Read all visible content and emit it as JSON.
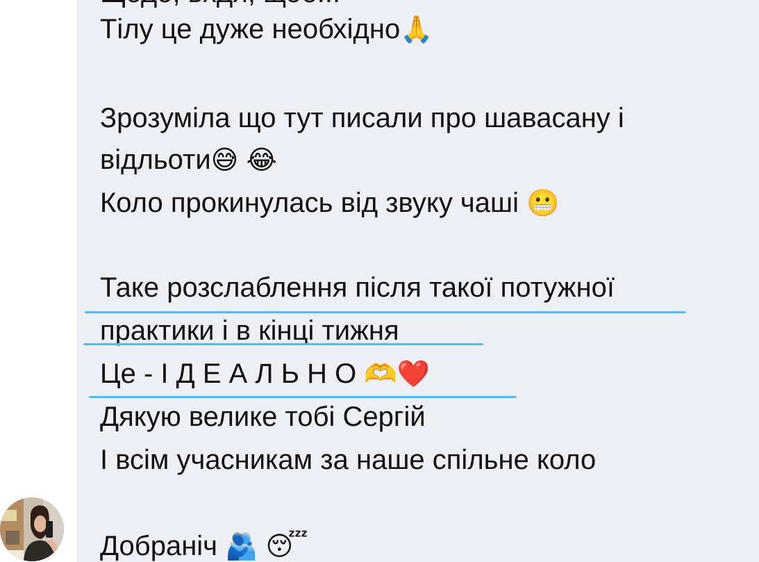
{
  "message": {
    "cut_text": "Щодо, вхдя, щоб...",
    "lines": [
      "Тілу це дуже необхідно",
      "Зрозуміла що тут писали про шавасану і",
      "відльоти",
      "Коло прокинулась від звуку чаші",
      "Таке розслаблення після такої потужної",
      "практики і в кінці тижня",
      "Це -  І Д Е А Л Ь Н О",
      "Дякую велике тобі Сергій",
      "І всім учасникам за наше спільне коло",
      "Добраніч"
    ],
    "emojis": {
      "pray": "🙏",
      "sweat_smile": "😅",
      "joy": "😂",
      "grimacing": "😬",
      "heart_hands": "🫶",
      "red_heart": "❤️",
      "hug": "🫂",
      "sleeping": "😴"
    }
  },
  "colors": {
    "bubble_background": "#eeeff4",
    "text": "#111111",
    "underline": "#5bb8ea"
  },
  "avatar": {
    "icon": "user-photo-avatar"
  }
}
